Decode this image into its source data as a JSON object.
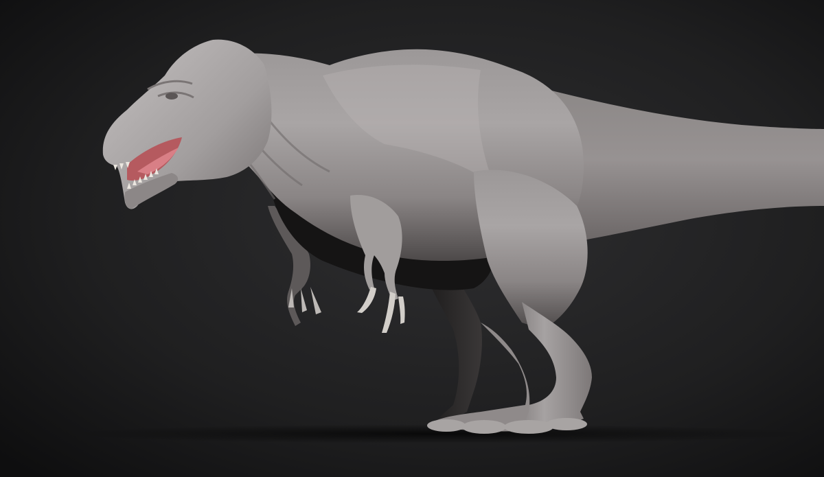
{
  "scene": {
    "subject": "dinosaur-sculpt",
    "colors": {
      "background_center": "#2c2c2e",
      "background_edge": "#0f0f10",
      "skin_light": "#b3b0b0",
      "skin_mid": "#8f8a8a",
      "skin_dark": "#4a4646",
      "shadow": "#0a0a0a",
      "mouth": "#b55a5f",
      "teeth": "#e8e4de"
    }
  }
}
